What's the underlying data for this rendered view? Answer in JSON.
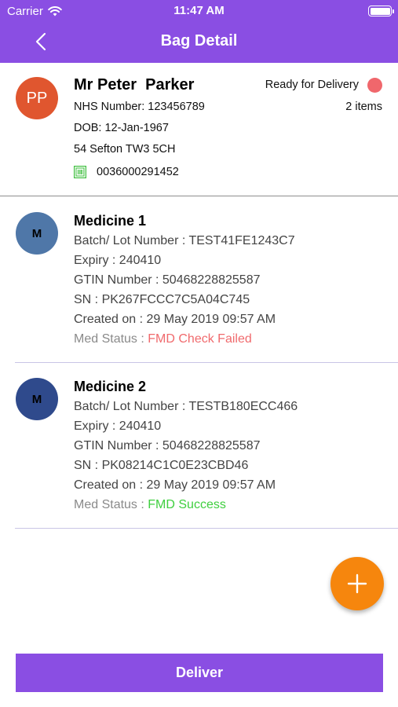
{
  "status_bar": {
    "carrier": "Carrier",
    "time": "11:47 AM",
    "battery_level": 1.0
  },
  "nav": {
    "title": "Bag Detail",
    "back_icon": "chevron-left-icon"
  },
  "patient": {
    "initials": "PP",
    "avatar_color": "#e0562f",
    "name": "Mr Peter  Parker",
    "nhs": "NHS Number: 123456789",
    "dob": "DOB: 12-Jan-1967",
    "address": "54 Sefton TW3 5CH",
    "barcode": "0036000291452",
    "barcode_icon": "barcode-icon",
    "status": "Ready for Delivery",
    "status_color": "#f0676c",
    "items": "2 items"
  },
  "medicines": [
    {
      "initial": "M",
      "avatar_color": "#4f77a8",
      "title": "Medicine 1",
      "batch": "Batch/ Lot Number : TEST41FE1243C7",
      "expiry": "Expiry : 240410",
      "gtin": "GTIN Number : 50468228825587",
      "sn": "SN : PK267FCCC7C5A04C745",
      "created": "Created on : 29 May 2019 09:57 AM",
      "status_label": "Med Status : ",
      "status_value": "FMD Check Failed",
      "status_color": "#f06a6d"
    },
    {
      "initial": "M",
      "avatar_color": "#2f4a8c",
      "title": "Medicine 2",
      "batch": "Batch/ Lot Number : TESTB180ECC466",
      "expiry": "Expiry : 240410",
      "gtin": "GTIN Number : 50468228825587",
      "sn": "SN : PK08214C1C0E23CBD46",
      "created": "Created on : 29 May 2019 09:57 AM",
      "status_label": "Med Status : ",
      "status_value": "FMD Success",
      "status_color": "#3fcf3f"
    }
  ],
  "fab": {
    "icon": "plus-icon",
    "color": "#f6860d"
  },
  "deliver": {
    "label": "Deliver"
  },
  "colors": {
    "brand": "#8a4ee3",
    "divider": "#c9c5e6"
  }
}
